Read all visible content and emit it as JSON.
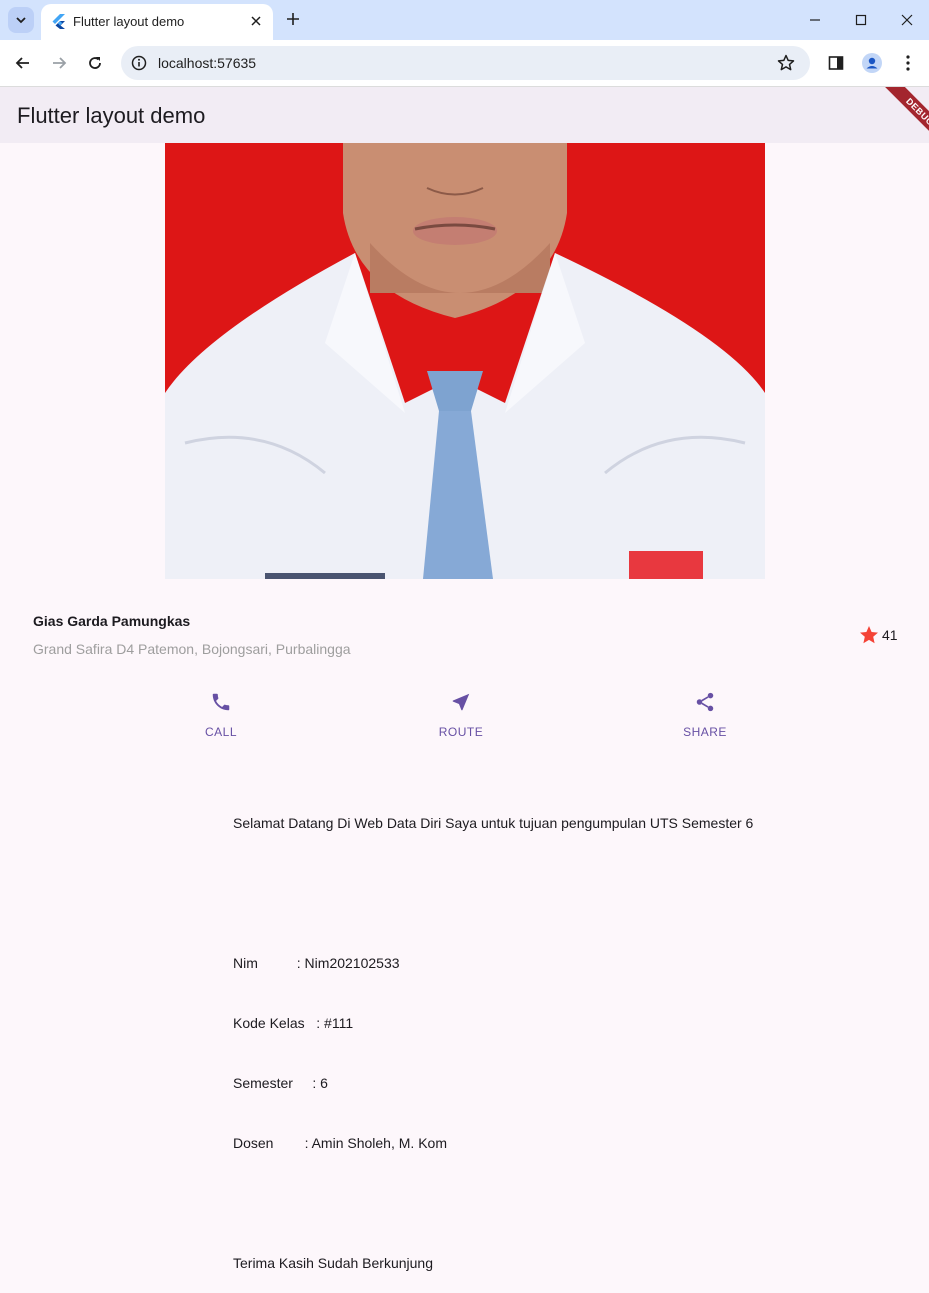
{
  "browser": {
    "tab_title": "Flutter layout demo",
    "url": "localhost:57635"
  },
  "app": {
    "title": "Flutter layout demo",
    "debug_label": "DEBUG"
  },
  "profile": {
    "name": "Gias Garda Pamungkas",
    "address": "Grand Safira D4 Patemon, Bojongsari, Purbalingga",
    "rating_count": "41",
    "star_color": "#f44336"
  },
  "actions": [
    {
      "label": "CALL",
      "icon": "phone-icon"
    },
    {
      "label": "ROUTE",
      "icon": "near-me-icon"
    },
    {
      "label": "SHARE",
      "icon": "share-icon"
    }
  ],
  "description": {
    "welcome": "Selamat Datang Di Web Data Diri Saya untuk tujuan pengumpulan UTS Semester 6",
    "nim": "Nim          : Nim202102533",
    "kode_kelas": "Kode Kelas   : #111",
    "semester": "Semester     : 6",
    "dosen": "Dosen        : Amin Sholeh, M. Kom",
    "thanks": "Terima Kasih Sudah Berkunjung"
  },
  "colors": {
    "accent": "#6750a4",
    "photo_background": "#dd1616"
  }
}
